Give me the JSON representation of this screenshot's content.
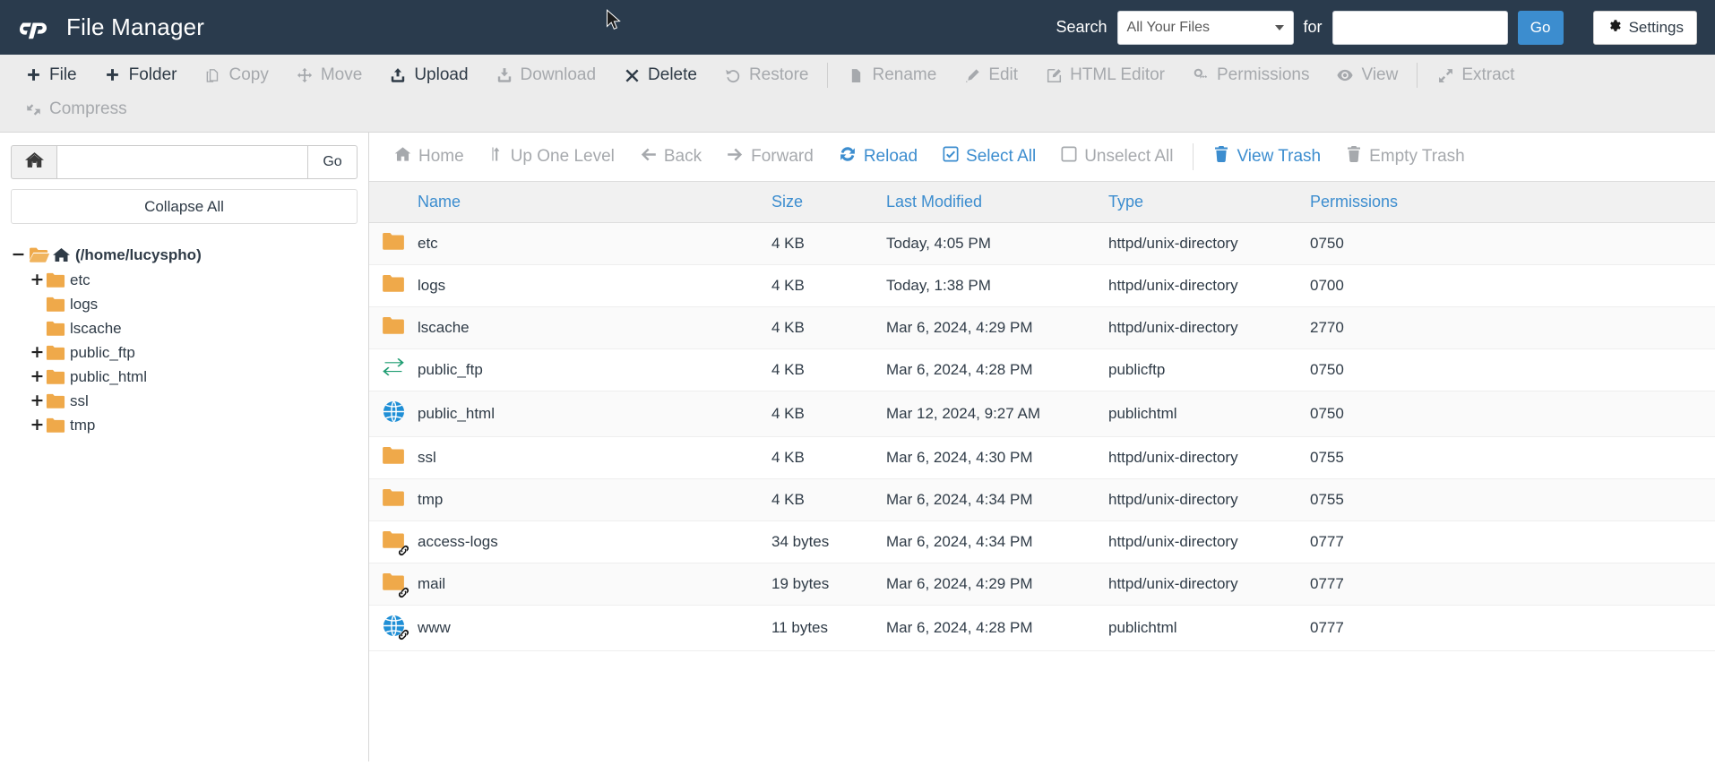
{
  "header": {
    "logo_icon": "cpanel-logo-icon",
    "title": "File Manager",
    "search_label": "Search",
    "search_scope_value": "All Your Files",
    "search_scope_options": [
      "All Your Files"
    ],
    "for_label": "for",
    "search_value": "",
    "search_placeholder": "",
    "go_label": "Go",
    "settings_label": "Settings",
    "settings_icon": "gear-icon"
  },
  "toolbar": {
    "items": [
      {
        "label": "File",
        "icon": "plus-icon",
        "disabled": false
      },
      {
        "label": "Folder",
        "icon": "plus-icon",
        "disabled": false
      },
      {
        "label": "Copy",
        "icon": "copy-icon",
        "disabled": true
      },
      {
        "label": "Move",
        "icon": "move-icon",
        "disabled": true
      },
      {
        "label": "Upload",
        "icon": "upload-icon",
        "disabled": false
      },
      {
        "label": "Download",
        "icon": "download-icon",
        "disabled": true
      },
      {
        "label": "Delete",
        "icon": "times-icon",
        "disabled": false
      },
      {
        "label": "Restore",
        "icon": "undo-icon",
        "disabled": true
      },
      {
        "separator": true
      },
      {
        "label": "Rename",
        "icon": "file-icon",
        "disabled": true
      },
      {
        "label": "Edit",
        "icon": "pencil-icon",
        "disabled": true
      },
      {
        "label": "HTML Editor",
        "icon": "html-editor-icon",
        "disabled": true
      },
      {
        "label": "Permissions",
        "icon": "key-icon",
        "disabled": true
      },
      {
        "label": "View",
        "icon": "eye-icon",
        "disabled": true
      },
      {
        "separator": true
      },
      {
        "label": "Extract",
        "icon": "expand-icon",
        "disabled": true
      }
    ],
    "row2": [
      {
        "label": "Compress",
        "icon": "compress-icon",
        "disabled": true
      }
    ]
  },
  "sidebar": {
    "home_button_icon": "home-icon",
    "path_value": "",
    "path_placeholder": "",
    "go_label": "Go",
    "collapse_all_label": "Collapse All",
    "tree": [
      {
        "label": "(/home/lucyspho)",
        "level": 0,
        "expander": "minus",
        "icon": "folder-open-home-icon",
        "bold": true
      },
      {
        "label": "etc",
        "level": 1,
        "expander": "plus",
        "icon": "folder-icon",
        "bold": false
      },
      {
        "label": "logs",
        "level": 1,
        "expander": "",
        "icon": "folder-icon",
        "bold": false
      },
      {
        "label": "lscache",
        "level": 1,
        "expander": "",
        "icon": "folder-icon",
        "bold": false
      },
      {
        "label": "public_ftp",
        "level": 1,
        "expander": "plus",
        "icon": "folder-icon",
        "bold": false
      },
      {
        "label": "public_html",
        "level": 1,
        "expander": "plus",
        "icon": "folder-icon",
        "bold": false
      },
      {
        "label": "ssl",
        "level": 1,
        "expander": "plus",
        "icon": "folder-icon",
        "bold": false
      },
      {
        "label": "tmp",
        "level": 1,
        "expander": "plus",
        "icon": "folder-icon",
        "bold": false
      }
    ]
  },
  "navbar": {
    "items": [
      {
        "label": "Home",
        "icon": "home-icon",
        "disabled": true
      },
      {
        "label": "Up One Level",
        "icon": "arrow-up-icon",
        "disabled": true
      },
      {
        "label": "Back",
        "icon": "arrow-left-icon",
        "disabled": true
      },
      {
        "label": "Forward",
        "icon": "arrow-right-icon",
        "disabled": true
      },
      {
        "label": "Reload",
        "icon": "reload-icon",
        "disabled": false
      },
      {
        "label": "Select All",
        "icon": "checkbox-checked-icon",
        "disabled": false
      },
      {
        "label": "Unselect All",
        "icon": "checkbox-empty-icon",
        "disabled": true
      },
      {
        "separator": true
      },
      {
        "label": "View Trash",
        "icon": "trash-icon",
        "disabled": false
      },
      {
        "label": "Empty Trash",
        "icon": "trash-icon",
        "disabled": true
      }
    ]
  },
  "file_table": {
    "columns": [
      "Name",
      "Size",
      "Last Modified",
      "Type",
      "Permissions"
    ],
    "rows": [
      {
        "icon": "folder-icon",
        "name": "etc",
        "size": "4 KB",
        "modified": "Today, 4:05 PM",
        "type": "httpd/unix-directory",
        "permissions": "0750"
      },
      {
        "icon": "folder-icon",
        "name": "logs",
        "size": "4 KB",
        "modified": "Today, 1:38 PM",
        "type": "httpd/unix-directory",
        "permissions": "0700"
      },
      {
        "icon": "folder-icon",
        "name": "lscache",
        "size": "4 KB",
        "modified": "Mar 6, 2024, 4:29 PM",
        "type": "httpd/unix-directory",
        "permissions": "2770"
      },
      {
        "icon": "ftp-exchange-icon",
        "name": "public_ftp",
        "size": "4 KB",
        "modified": "Mar 6, 2024, 4:28 PM",
        "type": "publicftp",
        "permissions": "0750"
      },
      {
        "icon": "globe-icon",
        "name": "public_html",
        "size": "4 KB",
        "modified": "Mar 12, 2024, 9:27 AM",
        "type": "publichtml",
        "permissions": "0750"
      },
      {
        "icon": "folder-icon",
        "name": "ssl",
        "size": "4 KB",
        "modified": "Mar 6, 2024, 4:30 PM",
        "type": "httpd/unix-directory",
        "permissions": "0755"
      },
      {
        "icon": "folder-icon",
        "name": "tmp",
        "size": "4 KB",
        "modified": "Mar 6, 2024, 4:34 PM",
        "type": "httpd/unix-directory",
        "permissions": "0755"
      },
      {
        "icon": "folder-link-icon",
        "name": "access-logs",
        "size": "34 bytes",
        "modified": "Mar 6, 2024, 4:34 PM",
        "type": "httpd/unix-directory",
        "permissions": "0777"
      },
      {
        "icon": "folder-link-icon",
        "name": "mail",
        "size": "19 bytes",
        "modified": "Mar 6, 2024, 4:29 PM",
        "type": "httpd/unix-directory",
        "permissions": "0777"
      },
      {
        "icon": "globe-link-icon",
        "name": "www",
        "size": "11 bytes",
        "modified": "Mar 6, 2024, 4:28 PM",
        "type": "publichtml",
        "permissions": "0777"
      }
    ]
  },
  "colors": {
    "header_bg": "#2a3b4d",
    "accent_blue": "#3c8dcf",
    "folder_orange": "#efa94a",
    "globe_blue": "#1f8fd6",
    "ftp_green": "#1f9d72",
    "toolbar_bg": "#ececec",
    "disabled_text": "#a6a9ad"
  }
}
